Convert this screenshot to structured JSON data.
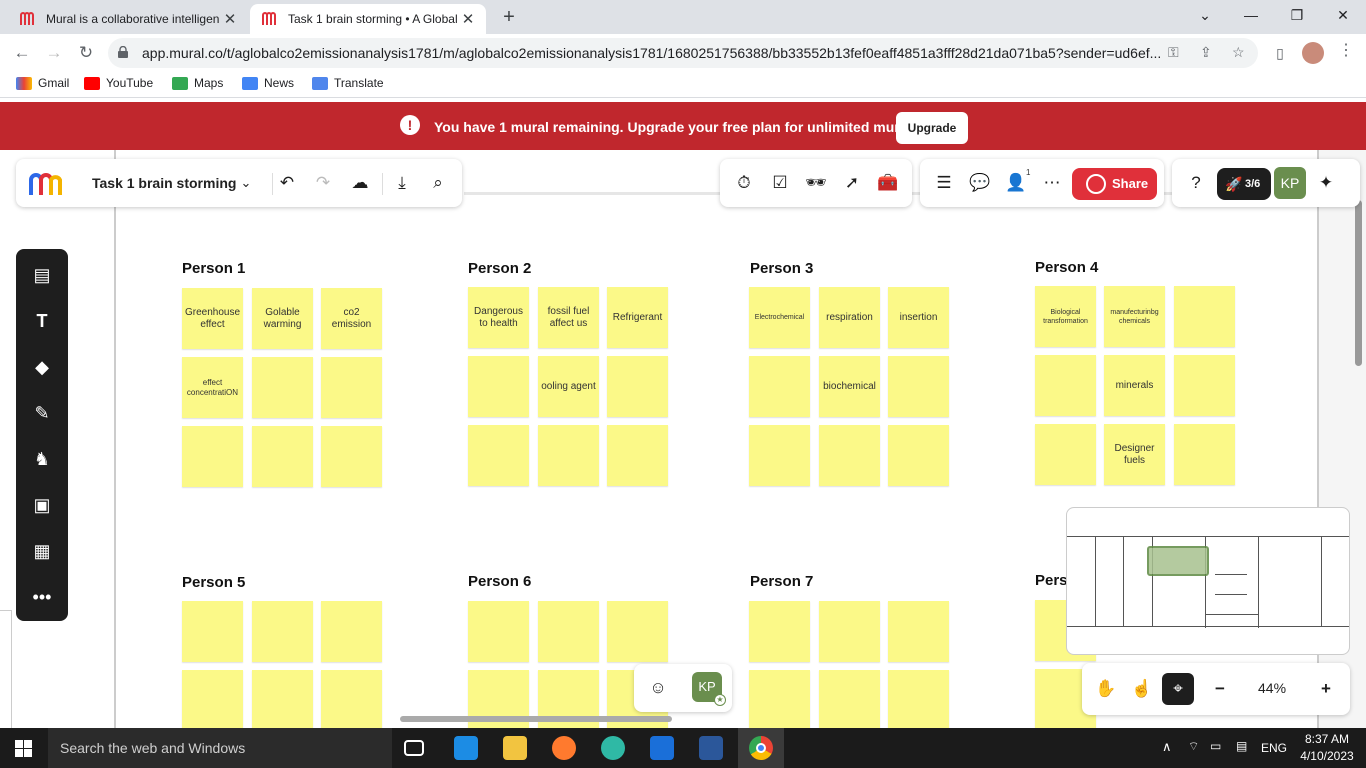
{
  "browser": {
    "tabs": [
      {
        "title": "Mural is a collaborative intelligen",
        "active": false
      },
      {
        "title": "Task 1 brain storming • A Global",
        "active": true
      }
    ],
    "url": "app.mural.co/t/aglobalco2emissionanalysis1781/m/aglobalco2emissionanalysis1781/1680251756388/bb33552b13fef0eaff4851a3fff28d21da071ba5?sender=ud6ef...",
    "bookmarks": [
      "Gmail",
      "YouTube",
      "Maps",
      "News",
      "Translate"
    ]
  },
  "banner": {
    "message": "You have 1 mural remaining. Upgrade your free plan for unlimited murals.",
    "button": "Upgrade"
  },
  "mural": {
    "title": "Task 1 brain storming",
    "share_label": "Share",
    "timer": "3/6",
    "avatar": "KP",
    "participants_count": "1",
    "zoom": "44%",
    "reaction_avatar": "KP"
  },
  "persons": [
    {
      "label": "Person 1",
      "notes": [
        "Greenhouse effect",
        "Golable warming",
        "co2 emission",
        "effect concentratiON",
        "",
        "",
        "",
        "",
        ""
      ]
    },
    {
      "label": "Person 2",
      "notes": [
        "Dangerous to health",
        "fossil fuel affect us",
        "Refrigerant",
        "",
        "ooling agent",
        "",
        "",
        "",
        ""
      ]
    },
    {
      "label": "Person 3",
      "notes": [
        "Electrochemical",
        "respiration",
        "insertion",
        "",
        "biochemical",
        "",
        "",
        "",
        ""
      ]
    },
    {
      "label": "Person 4",
      "notes": [
        "Biological transformation",
        "manufecturinbg chemicals",
        "",
        "",
        "minerals",
        "",
        "",
        "Designer fuels",
        ""
      ]
    },
    {
      "label": "Person 5",
      "notes": [
        "",
        "",
        "",
        "",
        "",
        ""
      ]
    },
    {
      "label": "Person 6",
      "notes": [
        "",
        "",
        "",
        "",
        "",
        ""
      ]
    },
    {
      "label": "Person 7",
      "notes": [
        "",
        "",
        "",
        "",
        "",
        ""
      ]
    },
    {
      "label": "Pers",
      "notes": [
        "",
        ""
      ]
    }
  ],
  "taskbar": {
    "search_placeholder": "Search the web and Windows",
    "lang": "ENG",
    "time": "8:37 AM",
    "date": "4/10/2023"
  },
  "colors": {
    "banner": "#c0272d",
    "note": "#fbf988",
    "share": "#e0303a",
    "avatar": "#6a8e4e"
  }
}
